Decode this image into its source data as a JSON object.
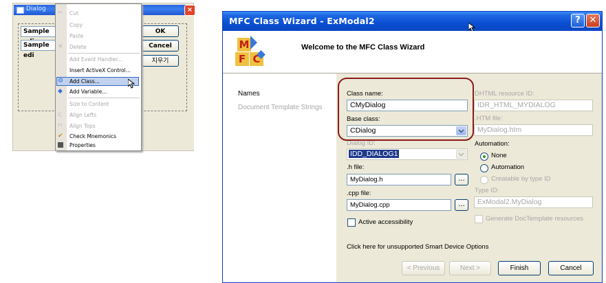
{
  "dialog_editor": {
    "title": "Dialog",
    "sample_edit_1": "Sample edi",
    "sample_edit_2": "Sample edi",
    "ok_label": "OK",
    "cancel_label": "Cancel",
    "korean_label": "지우기"
  },
  "context_menu": {
    "items": [
      {
        "label": "Cut",
        "enabled": false
      },
      {
        "label": "Copy",
        "enabled": false
      },
      {
        "label": "Paste",
        "enabled": false
      },
      {
        "label": "Delete",
        "enabled": false
      },
      {
        "label": "Add Event Handler...",
        "enabled": false
      },
      {
        "label": "Insert ActiveX Control...",
        "enabled": true
      },
      {
        "label": "Add Class...",
        "enabled": true,
        "highlighted": true
      },
      {
        "label": "Add Variable...",
        "enabled": true
      },
      {
        "label": "Size to Content",
        "enabled": false
      },
      {
        "label": "Align Lefts",
        "enabled": false
      },
      {
        "label": "Align Tops",
        "enabled": false
      },
      {
        "label": "Check Mnemonics",
        "enabled": true
      },
      {
        "label": "Properties",
        "enabled": true
      }
    ]
  },
  "wizard": {
    "title": "MFC Class Wizard - ExModal2",
    "help_glyph": "?",
    "close_glyph": "✕",
    "welcome": "Welcome to the MFC Class Wizard",
    "logo_letters": [
      "M",
      "F",
      "C"
    ],
    "nav": [
      "Names",
      "Document Template Strings"
    ],
    "class_name_label": "Class name:",
    "class_name_value": "CMyDialog",
    "base_class_label": "Base class:",
    "base_class_value": "CDialog",
    "dialog_id_label": "Dialog ID:",
    "dialog_id_value": "IDD_DIALOG1",
    "h_file_label": ".h file:",
    "h_file_value": "MyDialog.h",
    "cpp_file_label": ".cpp file:",
    "cpp_file_value": "MyDialog.cpp",
    "browse_label": "...",
    "active_accessibility_label": "Active accessibility",
    "dhtml_resource_id_label": "DHTML resource ID:",
    "dhtml_resource_id_value": "IDR_HTML_MYDIALOG",
    "htm_file_label": ".HTM file:",
    "htm_file_value": "MyDialog.htm",
    "automation_label": "Automation:",
    "automation_options": [
      "None",
      "Automation",
      "Creatable by type ID"
    ],
    "type_id_label": "Type ID:",
    "type_id_value": "ExModal2.MyDialog",
    "generate_doctemplate_label": "Generate DocTemplate resources",
    "smart_device_link": "Click here for unsupported Smart Device Options",
    "buttons": {
      "previous": "< Previous",
      "next": "Next >",
      "finish": "Finish",
      "cancel": "Cancel"
    },
    "highlight_color": "#8b1a1a"
  }
}
